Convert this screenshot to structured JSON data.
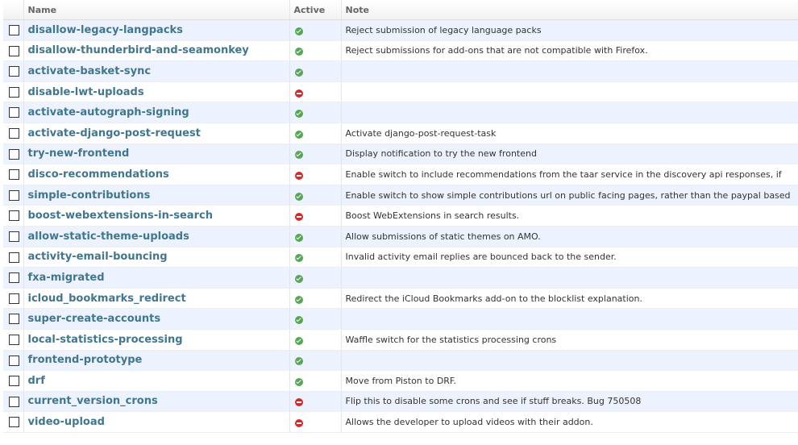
{
  "header": {
    "name_label": "Name",
    "active_label": "Active",
    "note_label": "Note"
  },
  "rows": [
    {
      "name": "disallow-legacy-langpacks",
      "active": true,
      "note": "Reject submission of legacy language packs"
    },
    {
      "name": "disallow-thunderbird-and-seamonkey",
      "active": true,
      "note": "Reject submissions for add-ons that are not compatible with Firefox."
    },
    {
      "name": "activate-basket-sync",
      "active": true,
      "note": ""
    },
    {
      "name": "disable-lwt-uploads",
      "active": false,
      "note": ""
    },
    {
      "name": "activate-autograph-signing",
      "active": true,
      "note": ""
    },
    {
      "name": "activate-django-post-request",
      "active": true,
      "note": "Activate django-post-request-task"
    },
    {
      "name": "try-new-frontend",
      "active": true,
      "note": "Display notification to try the new frontend"
    },
    {
      "name": "disco-recommendations",
      "active": false,
      "note": "Enable switch to include recommendations from the taar service in the discovery api responses, if"
    },
    {
      "name": "simple-contributions",
      "active": true,
      "note": "Enable switch to show simple contributions url on public facing pages, rather than the paypal based"
    },
    {
      "name": "boost-webextensions-in-search",
      "active": false,
      "note": "Boost WebExtensions in search results."
    },
    {
      "name": "allow-static-theme-uploads",
      "active": true,
      "note": "Allow submissions of static themes on AMO."
    },
    {
      "name": "activity-email-bouncing",
      "active": true,
      "note": "Invalid activity email replies are bounced back to the sender."
    },
    {
      "name": "fxa-migrated",
      "active": true,
      "note": ""
    },
    {
      "name": "icloud_bookmarks_redirect",
      "active": true,
      "note": "Redirect the iCloud Bookmarks add-on to the blocklist explanation."
    },
    {
      "name": "super-create-accounts",
      "active": true,
      "note": ""
    },
    {
      "name": "local-statistics-processing",
      "active": true,
      "note": "Waffle switch for the statistics processing crons"
    },
    {
      "name": "frontend-prototype",
      "active": true,
      "note": ""
    },
    {
      "name": "drf",
      "active": true,
      "note": "Move from Piston to DRF."
    },
    {
      "name": "current_version_crons",
      "active": false,
      "note": "Flip this to disable some crons and see if stuff breaks. Bug 750508"
    },
    {
      "name": "video-upload",
      "active": false,
      "note": "Allows the developer to upload videos with their addon."
    }
  ],
  "icons": {
    "active_true": "check-circle-icon",
    "active_false": "minus-circle-icon"
  },
  "colors": {
    "link": "#417690",
    "row_alt": "#edf3fe",
    "active_yes": "#56a754",
    "active_no": "#d12b2b"
  }
}
